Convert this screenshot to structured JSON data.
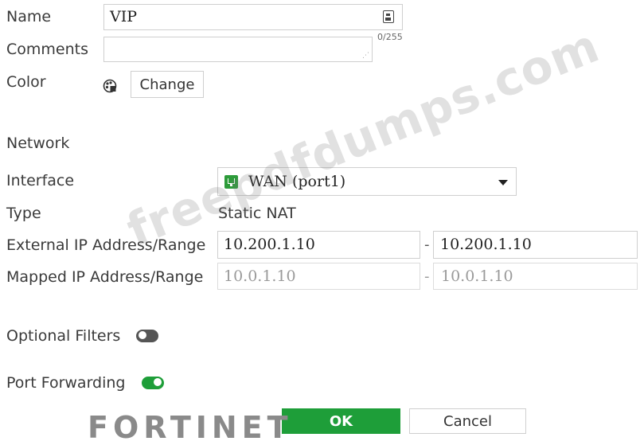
{
  "form": {
    "name_label": "Name",
    "name_value": "VIP",
    "comments_label": "Comments",
    "comments_counter": "0/255",
    "color_label": "Color",
    "change_button": "Change",
    "network_header": "Network",
    "interface_label": "Interface",
    "interface_value": "WAN (port1)",
    "type_label": "Type",
    "type_value": "Static NAT",
    "external_label": "External IP Address/Range",
    "external_start": "10.200.1.10",
    "external_end": "10.200.1.10",
    "mapped_label": "Mapped IP Address/Range",
    "mapped_start": "10.0.1.10",
    "mapped_end": "10.0.1.10",
    "range_separator": "-",
    "optional_filters_label": "Optional Filters",
    "optional_filters_enabled": false,
    "port_forwarding_label": "Port Forwarding",
    "port_forwarding_enabled": true
  },
  "buttons": {
    "ok": "OK",
    "cancel": "Cancel"
  },
  "overlay": {
    "watermark": "freepdfdumps.com",
    "logo": "FORTINET"
  },
  "colors": {
    "ok_green": "#1e9e39",
    "toggle_on": "#1e9e39",
    "toggle_off": "#555555"
  },
  "icons": {
    "name_field": "id-card-icon",
    "color": "palette-icon",
    "interface": "network-port-icon",
    "dropdown": "caret-down-icon"
  }
}
